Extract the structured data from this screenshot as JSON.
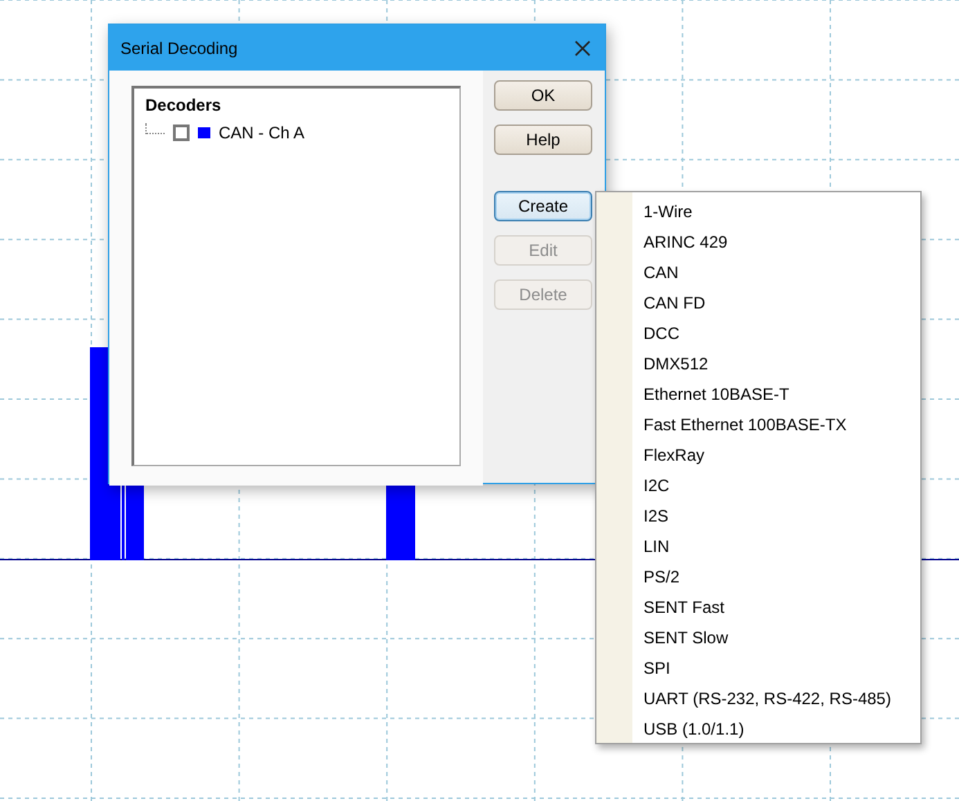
{
  "dialog": {
    "title": "Serial Decoding",
    "decoder_tree": {
      "heading": "Decoders",
      "items": [
        {
          "label": "CAN - Ch A",
          "checked": false,
          "color": "#0000ff"
        }
      ]
    },
    "buttons": [
      {
        "label": "OK",
        "disabled": false,
        "focused": false
      },
      {
        "label": "Help",
        "disabled": false,
        "focused": false
      },
      {
        "label": "Create",
        "disabled": false,
        "focused": true
      },
      {
        "label": "Edit",
        "disabled": true,
        "focused": false
      },
      {
        "label": "Delete",
        "disabled": true,
        "focused": false
      }
    ]
  },
  "create_menu": {
    "items": [
      "1-Wire",
      "ARINC 429",
      "CAN",
      "CAN FD",
      "DCC",
      "DMX512",
      "Ethernet 10BASE-T",
      "Fast Ethernet 100BASE-TX",
      "FlexRay",
      "I2C",
      "I2S",
      "LIN",
      "PS/2",
      "SENT Fast",
      "SENT Slow",
      "SPI",
      "UART (RS-232, RS-422, RS-485)",
      "USB (1.0/1.1)"
    ]
  }
}
